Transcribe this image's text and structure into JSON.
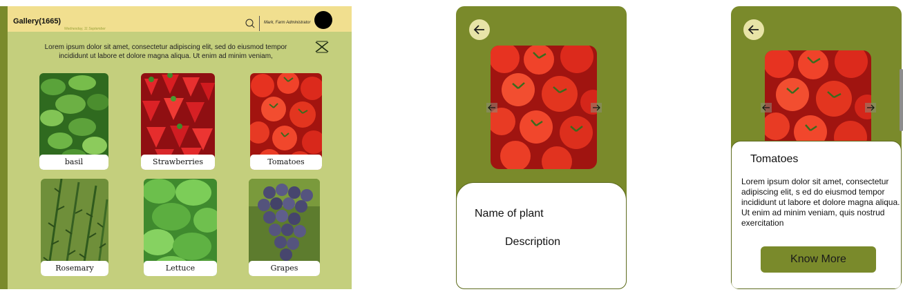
{
  "gallery": {
    "title": "Gallery(1665)",
    "date": "Wednesday, 11 September",
    "user": "Mark, Farm Administrator",
    "intro": "Lorem ipsum dolor sit amet, consectetur adipiscing elit, sed do eiusmod tempor incididunt ut labore et dolore magna aliqua. Ut enim ad minim veniam,",
    "items": [
      {
        "label": "basil",
        "image": "basil-leaves"
      },
      {
        "label": "Strawberries",
        "image": "strawberries"
      },
      {
        "label": "Tomatoes",
        "image": "tomatoes"
      },
      {
        "label": "Rosemary",
        "image": "rosemary-sprigs"
      },
      {
        "label": "Lettuce",
        "image": "lettuce-leaves"
      },
      {
        "label": "Grapes",
        "image": "grape-bunch"
      }
    ]
  },
  "detail_template": {
    "name_label": "Name of plant",
    "description_label": "Description"
  },
  "detail_filled": {
    "title": "Tomatoes",
    "description": "Lorem ipsum dolor sit amet, consectetur adipiscing elit, s ed do eiusmod tempor incididunt ut labore et dolore magna aliqua. Ut enim ad minim veniam, quis nostrud exercitation",
    "button_label": "Know More"
  },
  "icons": {
    "search": "search-icon",
    "close": "close-icon",
    "back": "back-arrow-icon",
    "prev": "arrow-left-icon",
    "next": "arrow-right-icon"
  },
  "colors": {
    "olive": "#7a8a2b",
    "light_olive": "#c4cf7d",
    "header_yellow": "#f1df8f",
    "back_button": "#e8e4a7"
  }
}
